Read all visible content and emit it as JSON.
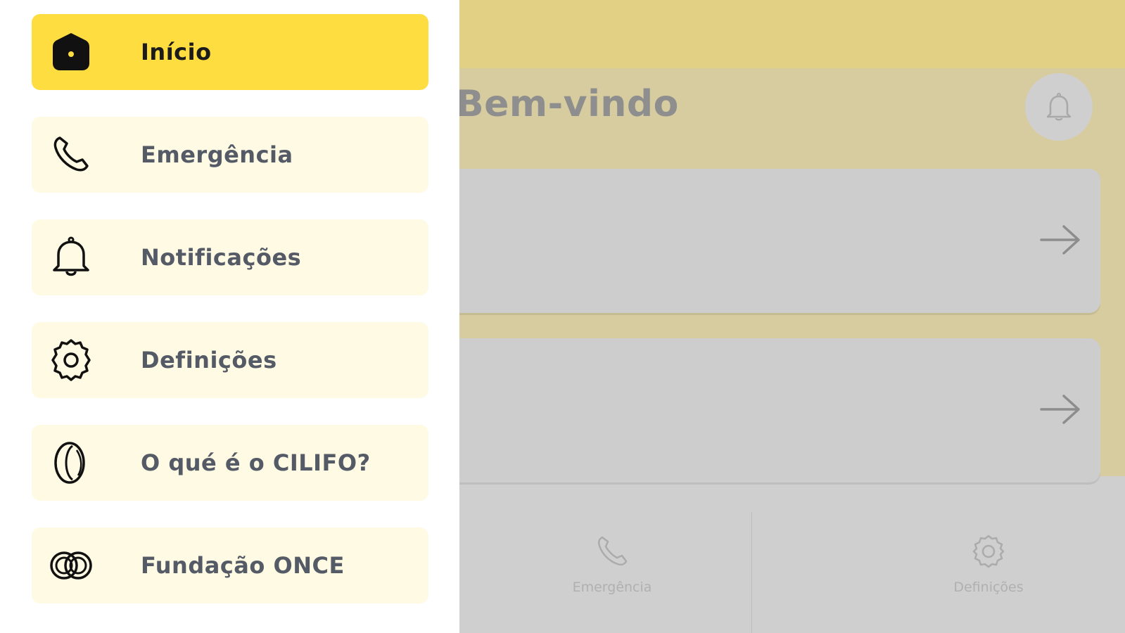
{
  "colors": {
    "accent": "#fddd3f",
    "menu_item_bg": "#fffae3",
    "menu_text": "#545b66",
    "overlay_bg": "#cfcfcf"
  },
  "drawer": {
    "items": [
      {
        "label": "Início",
        "icon": "home-icon",
        "active": true
      },
      {
        "label": "Emergência",
        "icon": "phone-icon",
        "active": false
      },
      {
        "label": "Notificações",
        "icon": "bell-icon",
        "active": false
      },
      {
        "label": "Definições",
        "icon": "gear-icon",
        "active": false
      },
      {
        "label": "O qué é o CILIFO?",
        "icon": "cilifo-logo-icon",
        "active": false
      },
      {
        "label": "Fundação ONCE",
        "icon": "once-logo-icon",
        "active": false
      }
    ]
  },
  "background": {
    "welcome_title": "Bem-vindo",
    "notification_button_icon": "bell-icon",
    "cards": [
      {
        "icon": "arrow-right-icon"
      },
      {
        "icon": "arrow-right-icon"
      }
    ],
    "tabbar": [
      {
        "label": "Emergência",
        "icon": "phone-icon"
      },
      {
        "label": "Definições",
        "icon": "gear-icon"
      }
    ]
  }
}
